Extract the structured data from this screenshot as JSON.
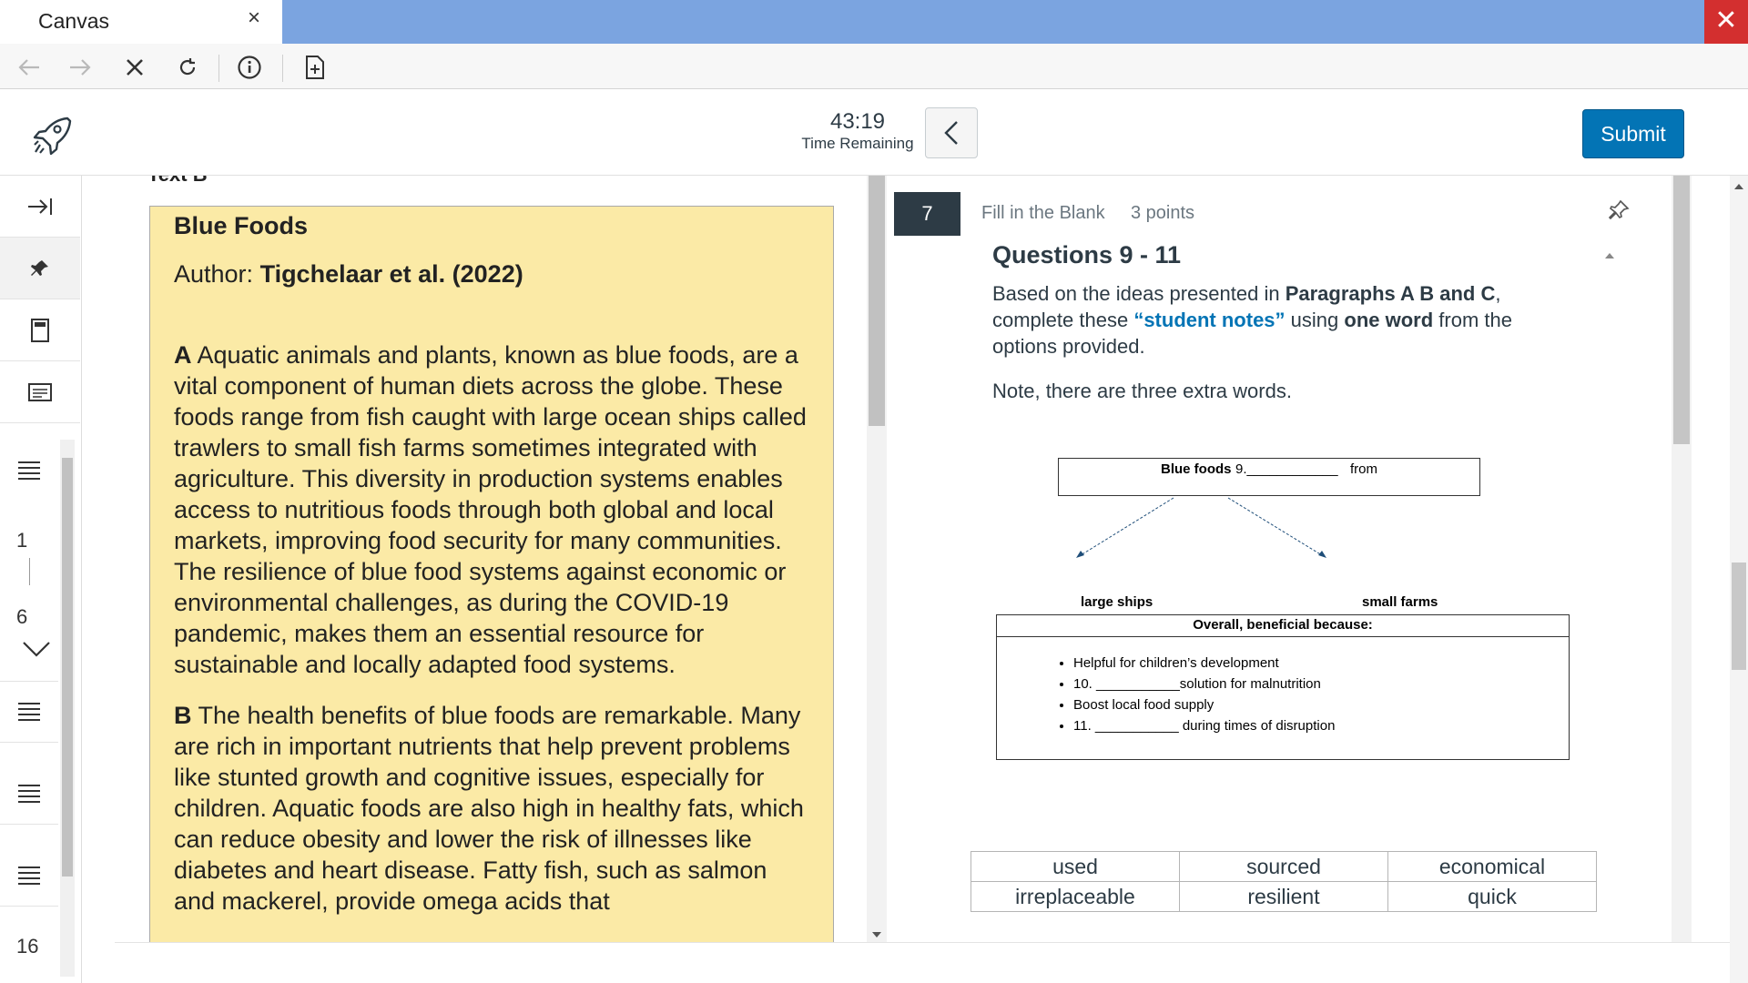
{
  "window": {
    "tab_title": "Canvas",
    "tab_close_glyph": "×",
    "close_glyph": "✕"
  },
  "toolbar": {
    "icons": [
      "back-arrow-icon",
      "forward-arrow-icon",
      "stop-icon",
      "reload-icon",
      "info-icon",
      "add-page-icon"
    ]
  },
  "quiz_header": {
    "timer_value": "43:19",
    "timer_label": "Time Remaining",
    "submit_label": "Submit"
  },
  "rail": {
    "page_start": "1",
    "page_end": "6",
    "page_next": "16"
  },
  "reading": {
    "section_label": "Text B",
    "title": "Blue Foods",
    "author_prefix": "Author: ",
    "author_name": "Tigchelaar et al. (2022)",
    "para_a_letter": "A",
    "para_a_text": " Aquatic animals and plants, known as blue foods, are a vital component of human diets across the globe. These foods range from fish caught with large ocean ships called trawlers to small fish farms sometimes integrated with agriculture. This diversity in production systems enables access to nutritious foods through both global and local markets, improving food security for many communities. The resilience of blue food systems against economic or environmental challenges, as during the COVID-19 pandemic, makes them an essential resource for sustainable and locally adapted food systems.",
    "para_b_letter": "B",
    "para_b_text": " The health benefits of blue foods are remarkable. Many are rich in important nutrients that help prevent problems like stunted growth and cognitive issues, especially for children. Aquatic foods are also high in healthy fats, which can reduce obesity and lower the risk of illnesses like diabetes and heart disease. Fatty fish, such as salmon and mackerel, provide omega acids that"
  },
  "question": {
    "number": "7",
    "type": "Fill in the Blank",
    "points": "3 points",
    "heading": "Questions 9 - 11",
    "text_1": "Based on the ideas presented in ",
    "text_bold_1": "Paragraphs A B and C",
    "text_2": ", complete these ",
    "text_blue": "“student notes”",
    "text_3": " using ",
    "text_bold_2": "one word",
    "text_4": " from the options provided.",
    "note": "Note, there are three extra words."
  },
  "diagram": {
    "top_label": "Blue foods",
    "top_blank": "9.____________",
    "top_from": "from",
    "left_label": "large ships",
    "right_label": "small farms",
    "bottom_heading": "Overall, beneficial because:",
    "bullets": [
      "Helpful for children’s development",
      "10. ___________solution for malnutrition",
      "Boost local food supply",
      "11. ___________ during times of disruption"
    ]
  },
  "word_bank": {
    "rows": [
      [
        "used",
        "sourced",
        "economical"
      ],
      [
        "irreplaceable",
        "resilient",
        "quick"
      ]
    ]
  },
  "colors": {
    "accent": "#0374b5",
    "passage_bg": "#fbeaa6",
    "title_bar": "#7ba4e0",
    "close_red": "#d32f2f",
    "question_badge": "#2d3b45"
  }
}
